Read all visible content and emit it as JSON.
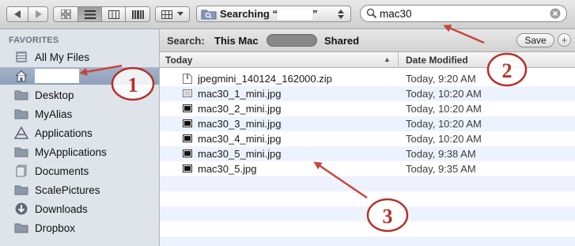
{
  "toolbar": {
    "nav": [
      "back-arrow",
      "forward-arrow"
    ],
    "view_modes": [
      "icon-view",
      "list-view",
      "column-view",
      "coverflow-view"
    ],
    "arrange": "arrange-menu",
    "path_popup_label": "Searching “",
    "path_popup_label_end": "”",
    "search_value": "mac30"
  },
  "sidebar": {
    "heading": "FAVORITES",
    "items": [
      {
        "label": "All My Files",
        "icon": "all-files-icon",
        "selected": false
      },
      {
        "label": "",
        "icon": "home-icon",
        "selected": true
      },
      {
        "label": "Desktop",
        "icon": "folder-icon",
        "selected": false
      },
      {
        "label": "MyAlias",
        "icon": "folder-icon",
        "selected": false
      },
      {
        "label": "Applications",
        "icon": "applications-icon",
        "selected": false
      },
      {
        "label": "MyApplications",
        "icon": "folder-icon",
        "selected": false
      },
      {
        "label": "Documents",
        "icon": "documents-icon",
        "selected": false
      },
      {
        "label": "ScalePictures",
        "icon": "folder-icon",
        "selected": false
      },
      {
        "label": "Downloads",
        "icon": "downloads-icon",
        "selected": false
      },
      {
        "label": "Dropbox",
        "icon": "folder-icon",
        "selected": false
      }
    ]
  },
  "scope": {
    "label": "Search:",
    "this_mac": "This Mac",
    "shared": "Shared",
    "save": "Save",
    "add": "+"
  },
  "list": {
    "col_name": "Today",
    "col_date": "Date Modified",
    "rows": [
      {
        "name": "jpegmini_140124_162000.zip",
        "date": "Today, 9:20 AM",
        "icon": "zip-file-icon"
      },
      {
        "name": "mac30_1_mini.jpg",
        "date": "Today, 10:20 AM",
        "icon": "image-file-icon"
      },
      {
        "name": "mac30_2_mini.jpg",
        "date": "Today, 10:20 AM",
        "icon": "image-file-icon"
      },
      {
        "name": "mac30_3_mini.jpg",
        "date": "Today, 10:20 AM",
        "icon": "image-file-icon"
      },
      {
        "name": "mac30_4_mini.jpg",
        "date": "Today, 10:20 AM",
        "icon": "image-file-icon"
      },
      {
        "name": "mac30_5_mini.jpg",
        "date": "Today, 9:38 AM",
        "icon": "image-file-icon"
      },
      {
        "name": "mac30_5.jpg",
        "date": "Today, 9:35 AM",
        "icon": "image-file-icon"
      }
    ]
  },
  "annotations": {
    "color": "#b5332c",
    "labels": [
      "1",
      "2",
      "3"
    ]
  }
}
